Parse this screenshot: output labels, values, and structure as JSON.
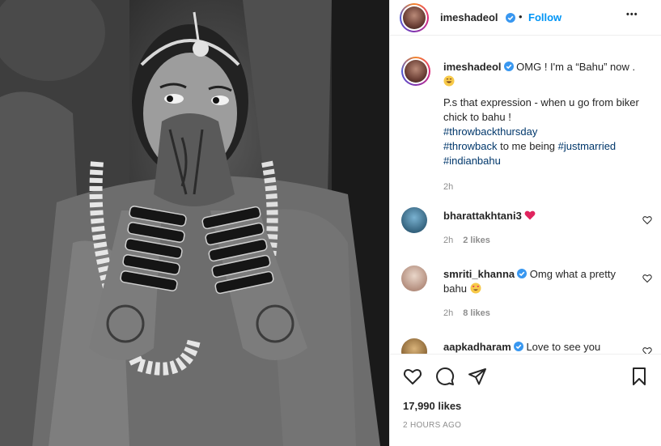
{
  "post": {
    "username": "imeshadeol",
    "follow_label": "Follow",
    "dot": "•",
    "more_label": "•••"
  },
  "caption": {
    "username": "imeshadeol",
    "line1": "OMG ! I'm a “Bahu” now .",
    "line2": "P.s that expression - when u go from biker chick to bahu !",
    "hashtag1": "#throwbackthursday",
    "hashtag2": "#throwback",
    "mid_text": " to me being ",
    "hashtag3": "#justmarried",
    "hashtag4": "#indianbahu",
    "time": "2h"
  },
  "comments": [
    {
      "username": "bharattakhtani3",
      "text": "",
      "time": "2h",
      "likes": "2 likes",
      "verified": false
    },
    {
      "username": "smriti_khanna",
      "text": "Omg what a pretty bahu",
      "time": "2h",
      "likes": "8 likes",
      "verified": true
    },
    {
      "username": "aapkadharam",
      "text": "Love to see you",
      "time": "",
      "likes": "",
      "verified": true
    }
  ],
  "footer": {
    "likes": "17,990 likes",
    "timestamp": "2 HOURS AGO"
  },
  "colors": {
    "link_blue": "#0095f6",
    "hashtag": "#00376b",
    "heart_red": "#ed4956",
    "meta_gray": "#8e8e8e"
  },
  "icons": [
    "verified-badge-icon",
    "more-options-icon",
    "heart-icon",
    "comment-icon",
    "share-icon",
    "bookmark-icon",
    "red-heart-emoji",
    "grinning-emoji",
    "heart-eyes-emoji"
  ]
}
